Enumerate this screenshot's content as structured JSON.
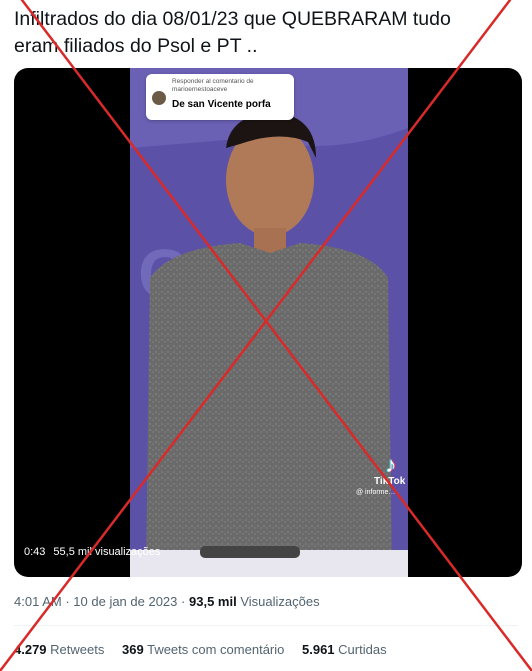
{
  "tweet": {
    "text_line1": "Infiltrados do dia 08/01/23 que QUEBRARAM tudo",
    "text_line2": "eram filiados do Psol e PT .."
  },
  "video": {
    "reply_caption": "Responder al comentario de marioernestoaceve",
    "reply_text": "De san Vicente porfa",
    "tiktok_brand": "TikTok",
    "tiktok_handle": "@ informe…",
    "duration": "0:43",
    "views": "55,5 mil visualizações"
  },
  "meta": {
    "time": "4:01 AM",
    "sep": "·",
    "date": "10 de jan de 2023",
    "views_count": "93,5 mil",
    "views_label": "Visualizações"
  },
  "stats": {
    "retweets_count": "4.279",
    "retweets_label": "Retweets",
    "comments_count": "369",
    "comments_label": "Tweets com comentário",
    "likes_count": "5.961",
    "likes_label": "Curtidas"
  },
  "colors": {
    "overlay_x": "#d92a2a",
    "text_secondary": "#536471"
  }
}
